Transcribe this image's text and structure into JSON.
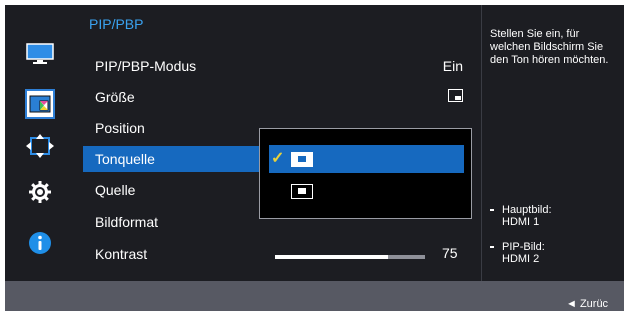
{
  "menu": {
    "title": "PIP/PBP",
    "items": [
      {
        "label": "PIP/PBP-Modus",
        "value": "Ein"
      },
      {
        "label": "Größe"
      },
      {
        "label": "Position"
      },
      {
        "label": "Tonquelle"
      },
      {
        "label": "Quelle"
      },
      {
        "label": "Bildformat"
      },
      {
        "label": "Kontrast",
        "value": "75"
      }
    ],
    "selected_index": 3
  },
  "contrast": {
    "value": 75,
    "max": 100
  },
  "dropdown": {
    "options": [
      {
        "icon": "pip-main-audio-icon",
        "selected": true
      },
      {
        "icon": "pip-sub-audio-icon",
        "selected": false
      }
    ]
  },
  "sidebar": {
    "icons": [
      "monitor-icon",
      "pip-icon",
      "position-arrows-icon",
      "gear-icon",
      "info-icon"
    ],
    "selected_index": 1
  },
  "help": {
    "text": "Stellen Sie ein, für welchen Bildschirm Sie den Ton hören möchten.",
    "sources": [
      {
        "label": "Hauptbild:",
        "value": "HDMI 1"
      },
      {
        "label": "PIP-Bild:",
        "value": "HDMI 2"
      }
    ]
  },
  "footer": {
    "back_label": "◄  Zurüc"
  },
  "colors": {
    "accent": "#1669bf",
    "title": "#3aa2f0",
    "panel": "#1c1d22",
    "frame": "#575963",
    "check": "#e8d23a"
  }
}
